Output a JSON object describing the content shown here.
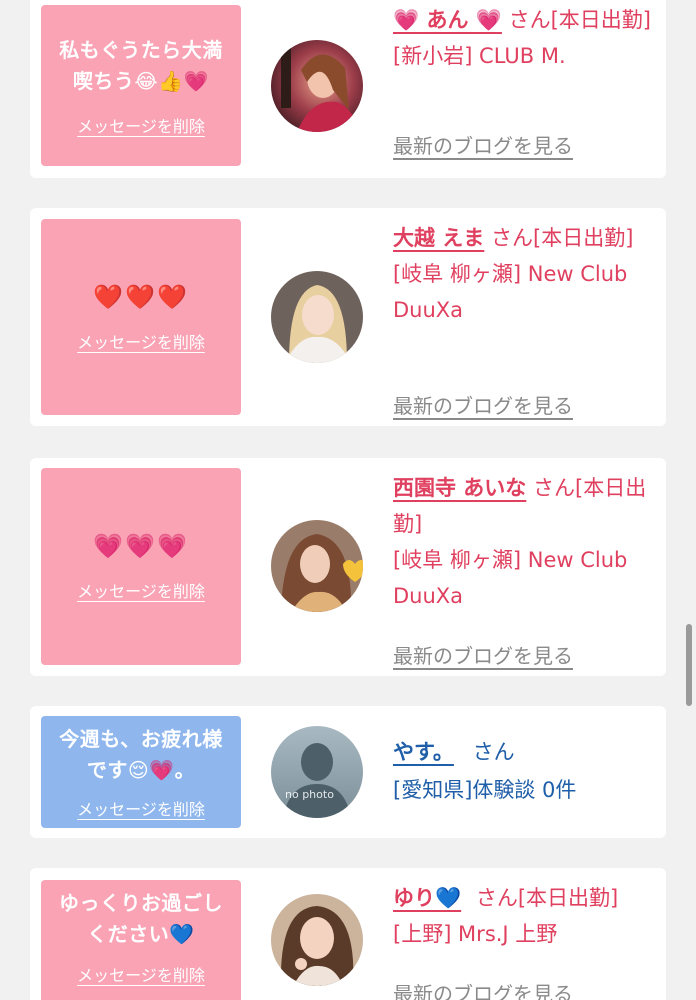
{
  "colors": {
    "pink_bubble": "#f9a3b5",
    "blue_bubble": "#8fb7ee",
    "name_pink": "#e0405f",
    "name_blue": "#1f5ea8",
    "link_gray": "#8a8a8a"
  },
  "cards": [
    {
      "message": "私もぐうたら大満\n喫ちう😂👍💗",
      "delete_label": "メッセージを削除",
      "name": "💗 あん 💗",
      "suffix": " さん",
      "status": "[本日出勤]",
      "shop": "[新小岩] CLUB M.",
      "blog_label": "最新のブログを見る"
    },
    {
      "message": "❤️❤️❤️",
      "delete_label": "メッセージを削除",
      "name": "大越 えま",
      "suffix": " さん",
      "status": "[本日出勤]",
      "shop": "[岐阜 柳ヶ瀬] New Club DuuXa",
      "blog_label": "最新のブログを見る"
    },
    {
      "message": "💗💗💗",
      "delete_label": "メッセージを削除",
      "name": "西園寺 あいな",
      "suffix": " さん",
      "status": "[本日出勤]",
      "shop": "[岐阜 柳ヶ瀬] New Club DuuXa",
      "blog_label": "最新のブログを見る"
    },
    {
      "message": "今週も、お疲れ様\nです😌💗。",
      "delete_label": "メッセージを削除",
      "name": "やす。",
      "suffix": " さん",
      "detail": "[愛知県]体験談 0件",
      "avatar_caption": "no photo"
    },
    {
      "message": "ゆっくりお過ごし\nください💙",
      "delete_label": "メッセージを削除",
      "name": "ゆり💙",
      "suffix": " さん",
      "status": "[本日出勤]",
      "shop": "[上野] Mrs.J 上野",
      "blog_label": "最新のブログを見る"
    }
  ]
}
